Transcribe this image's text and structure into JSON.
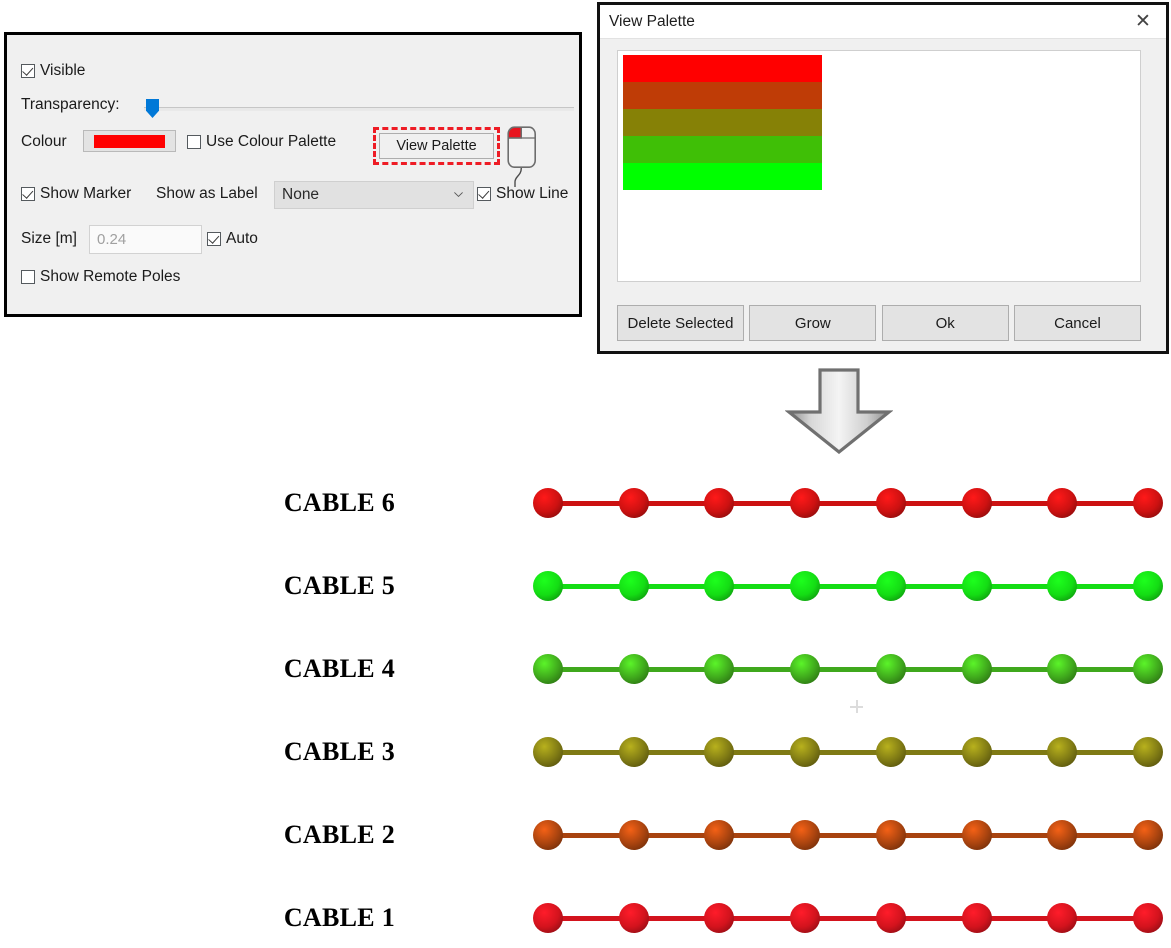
{
  "panel": {
    "visible": {
      "label": "Visible",
      "checked": true
    },
    "transparency": {
      "label": "Transparency:",
      "value": 0
    },
    "colour": {
      "label": "Colour",
      "swatch_color": "#ff0000"
    },
    "use_colour_palette": {
      "label": "Use Colour Palette",
      "checked": false
    },
    "view_palette_button": {
      "label": "View Palette",
      "highlight_color": "#ee1c25"
    },
    "show_marker": {
      "label": "Show Marker",
      "checked": true
    },
    "show_as_label": {
      "label": "Show as Label"
    },
    "label_combo": {
      "value": "None"
    },
    "show_line": {
      "label": "Show Line",
      "checked": true
    },
    "size": {
      "label": "Size [m]",
      "value": "0.24"
    },
    "auto": {
      "label": "Auto",
      "checked": true
    },
    "show_remote_poles": {
      "label": "Show Remote Poles",
      "checked": false
    },
    "mouse_icon": "mouse-left-click-icon"
  },
  "dialog": {
    "title": "View Palette",
    "close_icon": "close-icon",
    "swatches": [
      {
        "color": "#ff0000"
      },
      {
        "color": "#bf3c06"
      },
      {
        "color": "#868106"
      },
      {
        "color": "#3fbf06"
      },
      {
        "color": "#00ff00"
      }
    ],
    "buttons": [
      {
        "label": "Delete Selected"
      },
      {
        "label": "Grow"
      },
      {
        "label": "Ok"
      },
      {
        "label": "Cancel"
      }
    ]
  },
  "arrow": {
    "icon": "arrow-down-icon",
    "direction": "down"
  },
  "chart_data": {
    "type": "scatter",
    "title": "",
    "xlabel": "",
    "ylabel": "",
    "marker_count_per_series": 8,
    "categories": [
      "CABLE 1",
      "CABLE 2",
      "CABLE 3",
      "CABLE 4",
      "CABLE 5",
      "CABLE 6"
    ],
    "series": [
      {
        "name": "CABLE 6",
        "color": "#cc1111",
        "marker_color": "#cc1111",
        "line_color": "#cc1111",
        "row": 0,
        "values": [
          1,
          1,
          1,
          1,
          1,
          1,
          1,
          1
        ]
      },
      {
        "name": "CABLE 5",
        "color": "#14dd14",
        "marker_color": "#14dd14",
        "line_color": "#14dd14",
        "row": 1,
        "values": [
          1,
          1,
          1,
          1,
          1,
          1,
          1,
          1
        ]
      },
      {
        "name": "CABLE 4",
        "color": "#3fa81c",
        "marker_color": "#3fa81c",
        "line_color": "#3fa81c",
        "row": 2,
        "values": [
          1,
          1,
          1,
          1,
          1,
          1,
          1,
          1
        ]
      },
      {
        "name": "CABLE 3",
        "color": "#7f7a14",
        "marker_color": "#7f7a14",
        "line_color": "#7f7a14",
        "row": 3,
        "values": [
          1,
          1,
          1,
          1,
          1,
          1,
          1,
          1
        ]
      },
      {
        "name": "CABLE 2",
        "color": "#a8430f",
        "marker_color": "#a8430f",
        "line_color": "#a8430f",
        "row": 4,
        "values": [
          1,
          1,
          1,
          1,
          1,
          1,
          1,
          1
        ]
      },
      {
        "name": "CABLE 1",
        "color": "#d3131d",
        "marker_color": "#d3131d",
        "line_color": "#d3131d",
        "row": 5,
        "values": [
          1,
          1,
          1,
          1,
          1,
          1,
          1,
          1
        ]
      }
    ],
    "legend_position": "left",
    "grid": false
  }
}
